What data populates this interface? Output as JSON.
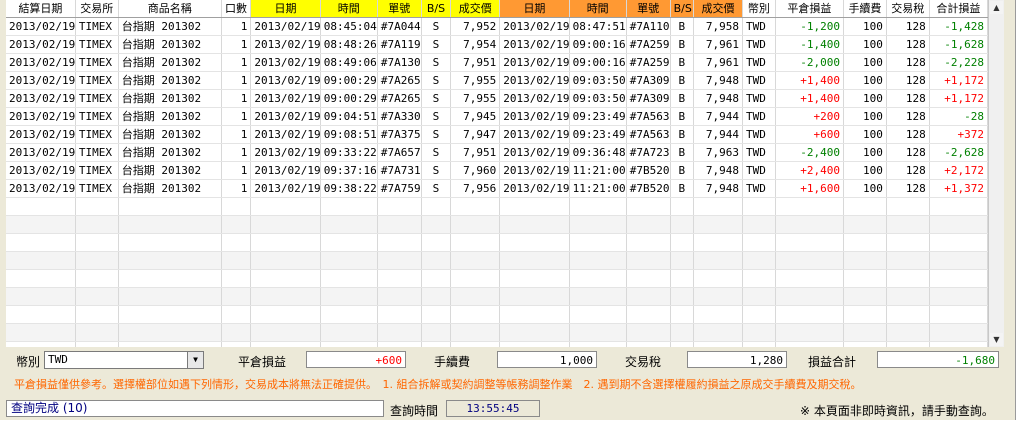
{
  "headers": [
    "結算日期",
    "交易所",
    "商品名稱",
    "口數",
    "日期",
    "時間",
    "單號",
    "B/S",
    "成交價",
    "日期",
    "時間",
    "單號",
    "B/S",
    "成交價",
    "幣別",
    "平倉損益",
    "手續費",
    "交易稅",
    "合計損益"
  ],
  "rows": [
    [
      "2013/02/19",
      "TIMEX",
      "台指期 201302",
      "1",
      "2013/02/19",
      "08:45:04",
      "#7A044",
      "S",
      "7,952",
      "2013/02/19",
      "08:47:51",
      "#7A110",
      "B",
      "7,958",
      "TWD",
      "-1,200",
      "100",
      "128",
      "-1,428"
    ],
    [
      "2013/02/19",
      "TIMEX",
      "台指期 201302",
      "1",
      "2013/02/19",
      "08:48:26",
      "#7A119",
      "S",
      "7,954",
      "2013/02/19",
      "09:00:16",
      "#7A259",
      "B",
      "7,961",
      "TWD",
      "-1,400",
      "100",
      "128",
      "-1,628"
    ],
    [
      "2013/02/19",
      "TIMEX",
      "台指期 201302",
      "1",
      "2013/02/19",
      "08:49:06",
      "#7A130",
      "S",
      "7,951",
      "2013/02/19",
      "09:00:16",
      "#7A259",
      "B",
      "7,961",
      "TWD",
      "-2,000",
      "100",
      "128",
      "-2,228"
    ],
    [
      "2013/02/19",
      "TIMEX",
      "台指期 201302",
      "1",
      "2013/02/19",
      "09:00:29",
      "#7A265",
      "S",
      "7,955",
      "2013/02/19",
      "09:03:50",
      "#7A309",
      "B",
      "7,948",
      "TWD",
      "+1,400",
      "100",
      "128",
      "+1,172"
    ],
    [
      "2013/02/19",
      "TIMEX",
      "台指期 201302",
      "1",
      "2013/02/19",
      "09:00:29",
      "#7A265",
      "S",
      "7,955",
      "2013/02/19",
      "09:03:50",
      "#7A309",
      "B",
      "7,948",
      "TWD",
      "+1,400",
      "100",
      "128",
      "+1,172"
    ],
    [
      "2013/02/19",
      "TIMEX",
      "台指期 201302",
      "1",
      "2013/02/19",
      "09:04:51",
      "#7A330",
      "S",
      "7,945",
      "2013/02/19",
      "09:23:49",
      "#7A563",
      "B",
      "7,944",
      "TWD",
      "+200",
      "100",
      "128",
      "-28"
    ],
    [
      "2013/02/19",
      "TIMEX",
      "台指期 201302",
      "1",
      "2013/02/19",
      "09:08:51",
      "#7A375",
      "S",
      "7,947",
      "2013/02/19",
      "09:23:49",
      "#7A563",
      "B",
      "7,944",
      "TWD",
      "+600",
      "100",
      "128",
      "+372"
    ],
    [
      "2013/02/19",
      "TIMEX",
      "台指期 201302",
      "1",
      "2013/02/19",
      "09:33:22",
      "#7A657",
      "S",
      "7,951",
      "2013/02/19",
      "09:36:48",
      "#7A723",
      "B",
      "7,963",
      "TWD",
      "-2,400",
      "100",
      "128",
      "-2,628"
    ],
    [
      "2013/02/19",
      "TIMEX",
      "台指期 201302",
      "1",
      "2013/02/19",
      "09:37:16",
      "#7A731",
      "S",
      "7,960",
      "2013/02/19",
      "11:21:00",
      "#7B520",
      "B",
      "7,948",
      "TWD",
      "+2,400",
      "100",
      "128",
      "+2,172"
    ],
    [
      "2013/02/19",
      "TIMEX",
      "台指期 201302",
      "1",
      "2013/02/19",
      "09:38:22",
      "#7A759",
      "S",
      "7,956",
      "2013/02/19",
      "11:21:00",
      "#7B520",
      "B",
      "7,948",
      "TWD",
      "+1,600",
      "100",
      "128",
      "+1,372"
    ]
  ],
  "summary": {
    "currency_label": "幣別",
    "currency_value": "TWD",
    "pl_label": "平倉損益",
    "pl_value": "+600",
    "fee_label": "手續費",
    "fee_value": "1,000",
    "tax_label": "交易稅",
    "tax_value": "1,280",
    "total_label": "損益合計",
    "total_value": "-1,680"
  },
  "note": "平倉損益僅供參考。選擇權部位如遇下列情形，交易成本將無法正確提供。　1. 組合拆解或契約調整等帳務調整作業　2. 遇到期不含選擇權履約損益之原成交手續費及期交稅。",
  "status": {
    "message": "查詢完成 (10)",
    "time_label": "查詢時間",
    "time_value": "13:55:45",
    "notice": "※ 本頁面非即時資訊，請手動查詢。"
  },
  "colors": {
    "positive": "#ff0000",
    "negative": "#008000",
    "open_header": "#ffff00",
    "close_header": "#ff9933",
    "note": "#ff6600"
  }
}
